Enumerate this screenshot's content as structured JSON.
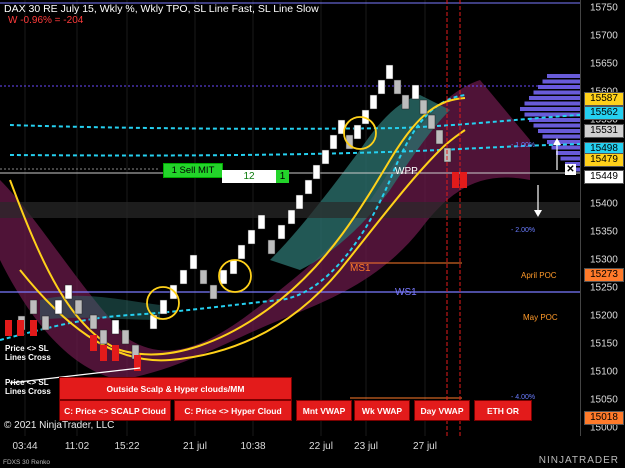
{
  "header": {
    "title": "DAX 30 RE July 15, Wkly %, Wkly TPO, SL Line Fast, SL Line Slow",
    "change": "W -0.96% = -204"
  },
  "price_axis": {
    "ticks": [
      "15750",
      "15700",
      "15650",
      "15600",
      "15550",
      "15500",
      "15450",
      "15400",
      "15350",
      "15300",
      "15250",
      "15200",
      "15150",
      "15100",
      "15050",
      "15000"
    ],
    "ticks_value": [
      15750,
      15700,
      15650,
      15600,
      15550,
      15500,
      15450,
      15400,
      15350,
      15300,
      15250,
      15200,
      15150,
      15100,
      15050,
      15000
    ]
  },
  "price_markers": [
    {
      "label": "15587",
      "color": "#ffd11a"
    },
    {
      "label": "15562",
      "color": "#25d0f0"
    },
    {
      "label": "15531",
      "color": "#d0d0d0"
    },
    {
      "label": "15498",
      "color": "#25d0f0"
    },
    {
      "label": "15479",
      "color": "#ffd11a"
    },
    {
      "label": "15449",
      "color": "#ffffff"
    },
    {
      "label": "15273",
      "color": "#ff7a2a"
    },
    {
      "label": "15018",
      "color": "#ff7a2a"
    }
  ],
  "time_axis": [
    "03:44",
    "11:02",
    "15:22",
    "21 jul",
    "10:38",
    "22 jul",
    "23 jul",
    "27 jul"
  ],
  "order": {
    "label": "1  Sell MIT",
    "quantity": "12",
    "qty_end": "1",
    "close_icon": "close-x-icon"
  },
  "levels": {
    "wpp": "WPP",
    "ms1": "MS1",
    "ws1": "WS1"
  },
  "percent_labels": [
    "- 1.00%",
    "- 2.00%",
    "- 4.00%"
  ],
  "poc_labels": [
    "April POC",
    "May POC"
  ],
  "annotations": [
    "Price <> SL Lines Cross",
    "Price <> SL Lines Cross"
  ],
  "buttons": {
    "outside_clouds": "Outside Scalp & Hyper clouds/MM",
    "scalp_cloud": "C: Price <> SCALP Cloud",
    "hyper_cloud": "C: Price <> Hyper Cloud",
    "mnt_vwap": "Mnt VWAP",
    "wk_vwap": "Wk VWAP",
    "day_vwap": "Day VWAP",
    "eth_or": "ETH OR"
  },
  "copyright": "© 2021 NinjaTrader, LLC",
  "footer": {
    "series": "FDXS 30 Renko",
    "logo": "NINJATRADER"
  },
  "colors": {
    "background": "#000000",
    "bull_candle": "#ffffff",
    "bear_candle": "#bdbdbd",
    "red_candle": "#e31b1b",
    "sl_line": "#ffd11a",
    "cyan_line": "#25d0f0",
    "cloud_teal": "#2a6e6a",
    "cloud_magenta": "#6a1a4a",
    "tpo_profile": "#7a6bff",
    "level_blue": "#7a7aff",
    "level_orange": "#ff7a2a"
  },
  "chart_data": {
    "type": "renko",
    "price_range": [
      15000,
      15760
    ],
    "brick_size": 25,
    "bricks": [
      {
        "x": "03:44",
        "open": 15150,
        "close": 15125,
        "dir": "down"
      },
      {
        "x": "11:02",
        "open": 15175,
        "close": 15200,
        "dir": "up"
      },
      {
        "x": "15:22",
        "open": 15175,
        "close": 15150,
        "dir": "down"
      },
      {
        "x": "21 jul",
        "open": 15250,
        "close": 15275,
        "dir": "up"
      },
      {
        "x": "10:38",
        "open": 15300,
        "close": 15325,
        "dir": "up"
      },
      {
        "x": "22 jul",
        "open": 15475,
        "close": 15500,
        "dir": "up"
      },
      {
        "x": "23 jul",
        "open": 15625,
        "close": 15650,
        "dir": "up"
      },
      {
        "x": "27 jul",
        "open": 15475,
        "close": 15450,
        "dir": "down"
      }
    ]
  }
}
